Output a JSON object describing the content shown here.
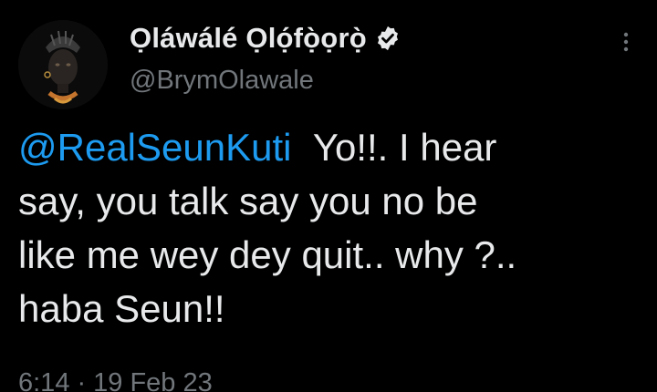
{
  "author": {
    "display_name": "Ọláwálé Ọlọ́fọ̀ọrọ̀",
    "handle": "@BrymOlawale",
    "verified": true,
    "avatar_icon": "profile-avatar",
    "verified_icon": "verified-badge-icon"
  },
  "tweet": {
    "mention": "@RealSeunKuti",
    "lines": [
      "Yo!!.  I hear",
      "say, you talk say you no be",
      "like me wey dey quit.. why ?..",
      "haba Seun!!"
    ]
  },
  "meta": {
    "time": "6:14",
    "separator": "·",
    "date": "19 Feb 23"
  },
  "menu": {
    "icon": "more-options-icon"
  },
  "colors": {
    "background": "#000000",
    "text": "#e7e9ea",
    "secondary": "#71767b",
    "accent": "#1d9bf0"
  }
}
